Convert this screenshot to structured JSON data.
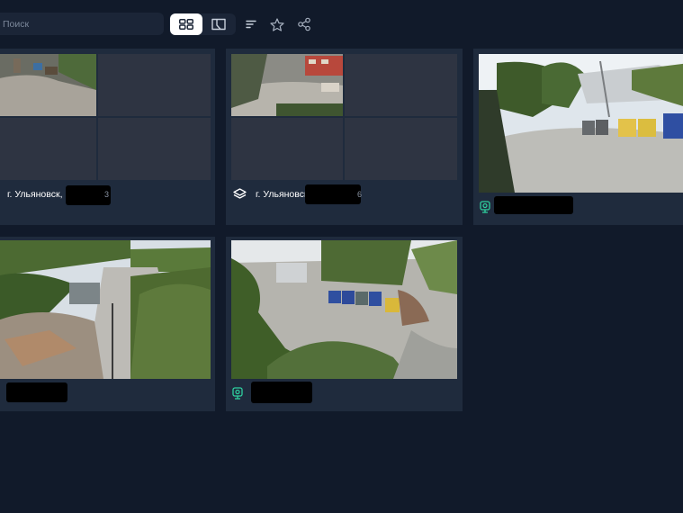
{
  "toolbar": {
    "search_placeholder": "Поиск",
    "view_toggle": {
      "grid_icon": "grid-view-icon",
      "map_icon": "map-view-icon",
      "active": "grid"
    },
    "icons": [
      "sort-icon",
      "star-icon",
      "share-icon"
    ]
  },
  "cards": [
    {
      "kind": "group",
      "icon": "city-label",
      "caption": "г. Ульяновск, г",
      "caption_suffix": "3"
    },
    {
      "kind": "group",
      "icon": "layers-icon",
      "caption": "г. Ульяновск",
      "caption_suffix": "6"
    },
    {
      "kind": "camera",
      "icon": "camera-icon",
      "caption": "",
      "caption_faded": ""
    },
    {
      "kind": "camera",
      "icon": "",
      "caption": ""
    },
    {
      "kind": "camera",
      "icon": "camera-icon",
      "caption": ""
    }
  ],
  "colors": {
    "background": "#111a2a",
    "card": "#1f2b3d",
    "accent_green": "#2fd1a0",
    "toggle_active": "#ffffff"
  }
}
